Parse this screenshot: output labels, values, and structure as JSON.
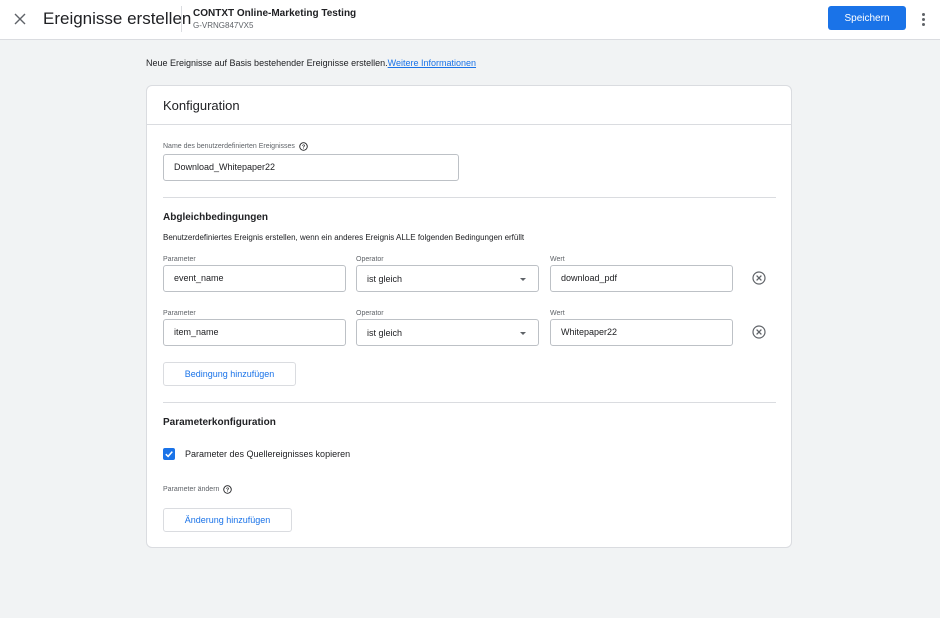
{
  "header": {
    "title": "Ereignisse erstellen",
    "account_name": "CONTXT Online-Marketing Testing",
    "account_id": "G-VRNG847VX5",
    "save_label": "Speichern"
  },
  "intro": {
    "text": "Neue Ereignisse auf Basis bestehender Ereignisse erstellen.",
    "link": "Weitere Informationen"
  },
  "card": {
    "title": "Konfiguration",
    "event_name": {
      "label": "Name des benutzerdefinierten Ereignisses",
      "value": "Download_Whitepaper22"
    },
    "conditions": {
      "title": "Abgleichbedingungen",
      "description": "Benutzerdefiniertes Ereignis erstellen, wenn ein anderes Ereignis ALLE folgenden Bedingungen erfüllt",
      "parameter_label": "Parameter",
      "operator_label": "Operator",
      "value_label": "Wert",
      "rows": [
        {
          "parameter": "event_name",
          "operator": "ist gleich",
          "value": "download_pdf"
        },
        {
          "parameter": "item_name",
          "operator": "ist gleich",
          "value": "Whitepaper22"
        }
      ],
      "add_label": "Bedingung hinzufügen"
    },
    "param_config": {
      "title": "Parameterkonfiguration",
      "copy_label": "Parameter des Quellereignisses kopieren",
      "copy_checked": true,
      "modify_label": "Parameter ändern",
      "add_modification_label": "Änderung hinzufügen"
    }
  },
  "colors": {
    "accent": "#1a73e8",
    "background": "#f1f3f4",
    "border": "#dadce0"
  }
}
